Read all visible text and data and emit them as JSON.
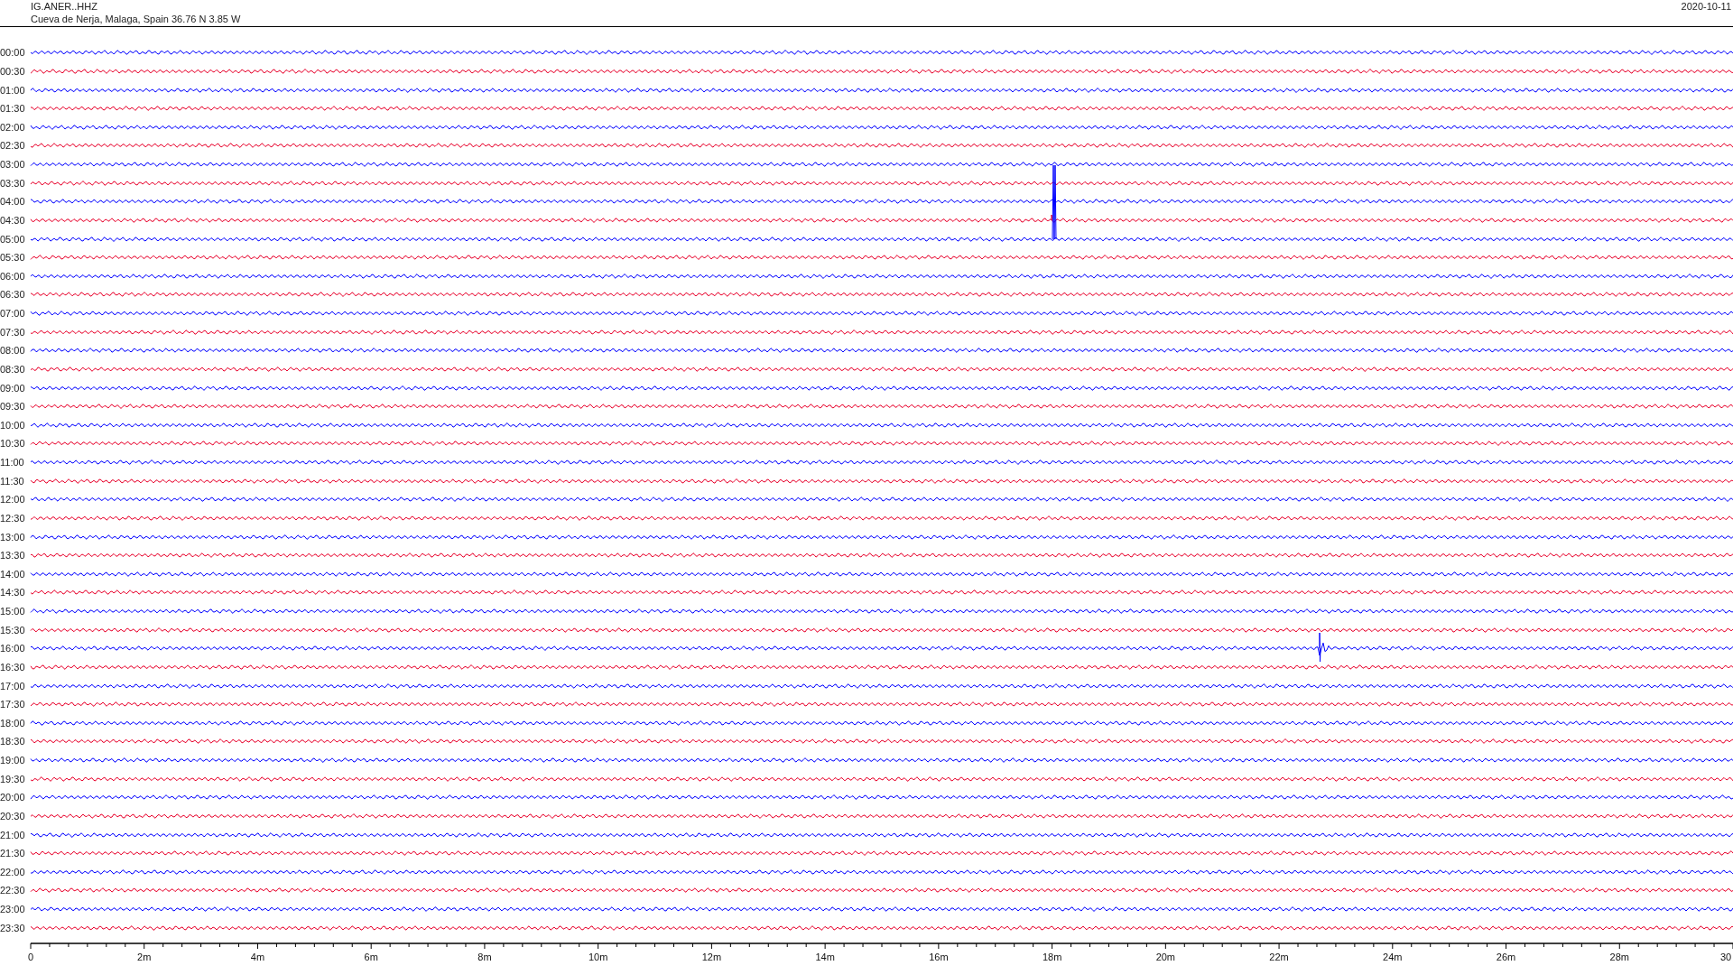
{
  "header": {
    "channel": "IG.ANER..HHZ",
    "location": "Cueva de Nerja, Malaga, Spain  36.76 N 3.85 W",
    "date": "2020-10-11"
  },
  "rows": [
    {
      "time": "00:00",
      "color": "#0000ff"
    },
    {
      "time": "00:30",
      "color": "#e8002a"
    },
    {
      "time": "01:00",
      "color": "#0000ff"
    },
    {
      "time": "01:30",
      "color": "#e8002a"
    },
    {
      "time": "02:00",
      "color": "#0000ff"
    },
    {
      "time": "02:30",
      "color": "#e8002a"
    },
    {
      "time": "03:00",
      "color": "#0000ff"
    },
    {
      "time": "03:30",
      "color": "#e8002a"
    },
    {
      "time": "04:00",
      "color": "#0000ff"
    },
    {
      "time": "04:30",
      "color": "#e8002a"
    },
    {
      "time": "05:00",
      "color": "#0000ff"
    },
    {
      "time": "05:30",
      "color": "#e8002a"
    },
    {
      "time": "06:00",
      "color": "#0000ff"
    },
    {
      "time": "06:30",
      "color": "#e8002a"
    },
    {
      "time": "07:00",
      "color": "#0000ff"
    },
    {
      "time": "07:30",
      "color": "#e8002a"
    },
    {
      "time": "08:00",
      "color": "#0000ff"
    },
    {
      "time": "08:30",
      "color": "#e8002a"
    },
    {
      "time": "09:00",
      "color": "#0000ff"
    },
    {
      "time": "09:30",
      "color": "#e8002a"
    },
    {
      "time": "10:00",
      "color": "#0000ff"
    },
    {
      "time": "10:30",
      "color": "#e8002a"
    },
    {
      "time": "11:00",
      "color": "#0000ff"
    },
    {
      "time": "11:30",
      "color": "#e8002a"
    },
    {
      "time": "12:00",
      "color": "#0000ff"
    },
    {
      "time": "12:30",
      "color": "#e8002a"
    },
    {
      "time": "13:00",
      "color": "#0000ff"
    },
    {
      "time": "13:30",
      "color": "#e8002a"
    },
    {
      "time": "14:00",
      "color": "#0000ff"
    },
    {
      "time": "14:30",
      "color": "#e8002a"
    },
    {
      "time": "15:00",
      "color": "#0000ff"
    },
    {
      "time": "15:30",
      "color": "#e8002a"
    },
    {
      "time": "16:00",
      "color": "#0000ff"
    },
    {
      "time": "16:30",
      "color": "#e8002a"
    },
    {
      "time": "17:00",
      "color": "#0000ff"
    },
    {
      "time": "17:30",
      "color": "#e8002a"
    },
    {
      "time": "18:00",
      "color": "#0000ff"
    },
    {
      "time": "18:30",
      "color": "#e8002a"
    },
    {
      "time": "19:00",
      "color": "#0000ff"
    },
    {
      "time": "19:30",
      "color": "#e8002a"
    },
    {
      "time": "20:00",
      "color": "#0000ff"
    },
    {
      "time": "20:30",
      "color": "#e8002a"
    },
    {
      "time": "21:00",
      "color": "#0000ff"
    },
    {
      "time": "21:30",
      "color": "#e8002a"
    },
    {
      "time": "22:00",
      "color": "#0000ff"
    },
    {
      "time": "22:30",
      "color": "#e8002a"
    },
    {
      "time": "23:00",
      "color": "#0000ff"
    },
    {
      "time": "23:30",
      "color": "#e8002a"
    }
  ],
  "x_axis": {
    "labels": [
      "0",
      "2m",
      "4m",
      "6m",
      "8m",
      "10m",
      "12m",
      "14m",
      "16m",
      "18m",
      "20m",
      "22m",
      "24m",
      "26m",
      "28m",
      "30"
    ]
  }
}
